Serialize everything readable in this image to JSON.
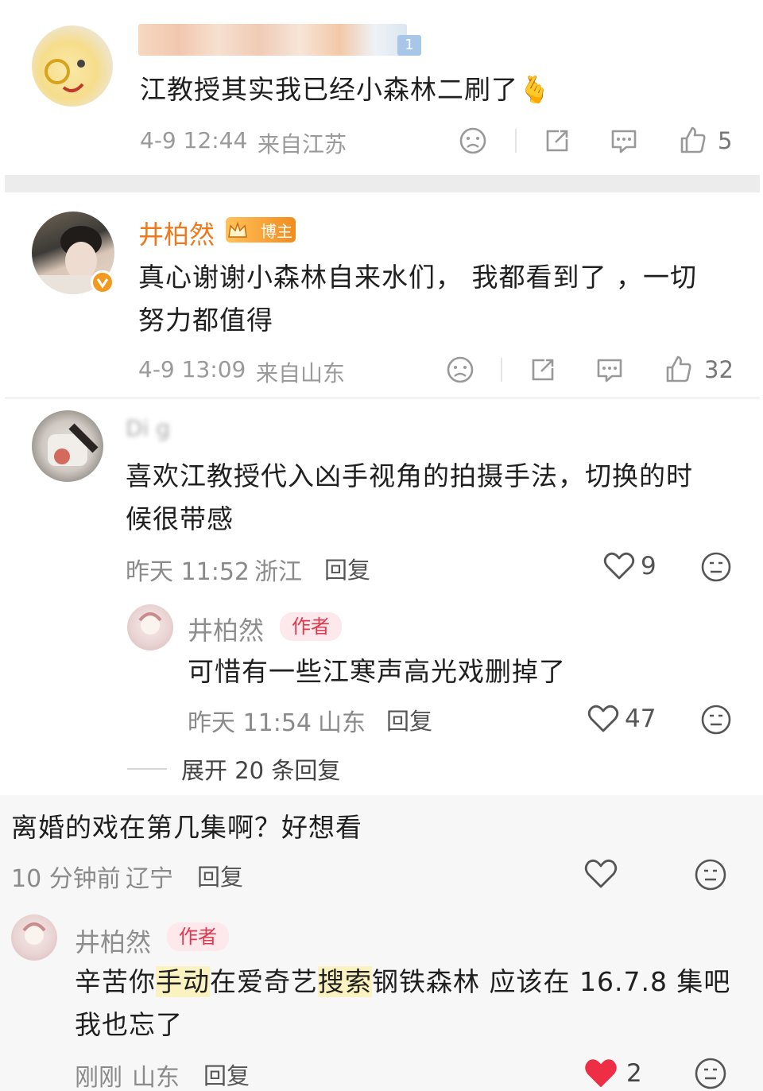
{
  "comment1": {
    "badge": "1",
    "text": "江教授其实我已经小森林二刷了🫰",
    "time": "4-9 12:44",
    "location": "来自江苏",
    "like_count": "5"
  },
  "comment2": {
    "name": "井柏然",
    "badge_label": "博主",
    "text_line1": "真心谢谢小森林自来水们， 我都看到了 ，一切",
    "text_line2": "努力都值得",
    "time": "4-9 13:09",
    "location": "来自山东",
    "like_count": "32"
  },
  "thread": {
    "user_name": "Di g",
    "text_line1": "喜欢江教授代入凶手视角的拍摄手法，切换的时",
    "text_line2": "候很带感",
    "time": "昨天 11:52",
    "location": "浙江",
    "reply_label": "回复",
    "like_count": "9",
    "author_reply": {
      "name": "井柏然",
      "tag": "作者",
      "text": "可惜有一些江寒声高光戏删掉了",
      "time": "昨天 11:54",
      "location": "山东",
      "reply_label": "回复",
      "like_count": "47"
    },
    "expand_label": "展开 20 条回复"
  },
  "comment4": {
    "text": "离婚的戏在第几集啊？好想看",
    "time": "10 分钟前",
    "location": "辽宁",
    "reply_label": "回复",
    "author_reply": {
      "name": "井柏然",
      "tag": "作者",
      "text_part1": "辛苦你",
      "text_hl1": "手动",
      "text_part2": "在爱奇艺",
      "text_hl2": "搜索",
      "text_part3": "钢铁森林 应该在 16.7.8 集吧",
      "text_line2": "我也忘了",
      "time": "刚刚",
      "location": "山东",
      "reply_label": "回复",
      "like_count": "2"
    }
  },
  "colors": {
    "author_orange": "#ee7a1c",
    "author_tag_red": "#e0394f",
    "liked_red": "#ee2e45"
  }
}
